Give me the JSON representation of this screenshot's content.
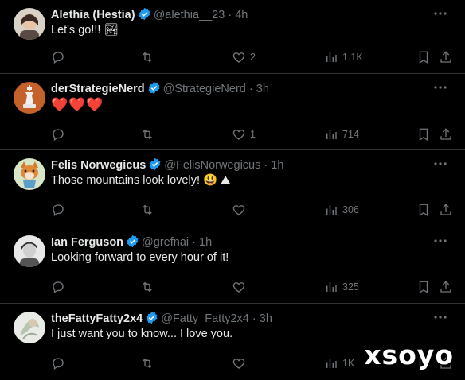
{
  "tweets": [
    {
      "name": "Alethia (Hestia)",
      "handle": "@alethia__23",
      "dot": "·",
      "time": "4h",
      "text": "Let's go!!!",
      "emoji": "🏞",
      "replies": "",
      "retweets": "",
      "likes": "2",
      "views": "1.1K"
    },
    {
      "name": "derStrategieNerd",
      "handle": "@StrategieNerd",
      "dot": "·",
      "time": "3h",
      "text": "❤️❤️❤️",
      "replies": "",
      "retweets": "",
      "likes": "1",
      "views": "714"
    },
    {
      "name": "Felis Norwegicus",
      "handle": "@FelisNorwegicus",
      "dot": "·",
      "time": "1h",
      "text": "Those mountains look lovely! 😃 ⛰",
      "replies": "",
      "retweets": "",
      "likes": "",
      "views": "306"
    },
    {
      "name": "Ian Ferguson",
      "handle": "@grefnai",
      "dot": "·",
      "time": "1h",
      "text": "Looking forward to every hour of it!",
      "replies": "",
      "retweets": "",
      "likes": "",
      "views": "325"
    },
    {
      "name": "theFattyFatty2x4",
      "handle": "@Fatty_Fatty2x4",
      "dot": "·",
      "time": "3h",
      "text": "I just want you to know... I love you.",
      "replies": "",
      "retweets": "",
      "likes": "",
      "views": "1K"
    }
  ],
  "watermark": "xsoyo",
  "colors": {
    "bg": "#000000",
    "text": "#e7e9ea",
    "muted": "#71767b",
    "verified": "#1d9bf0",
    "divider": "#2f3336"
  }
}
